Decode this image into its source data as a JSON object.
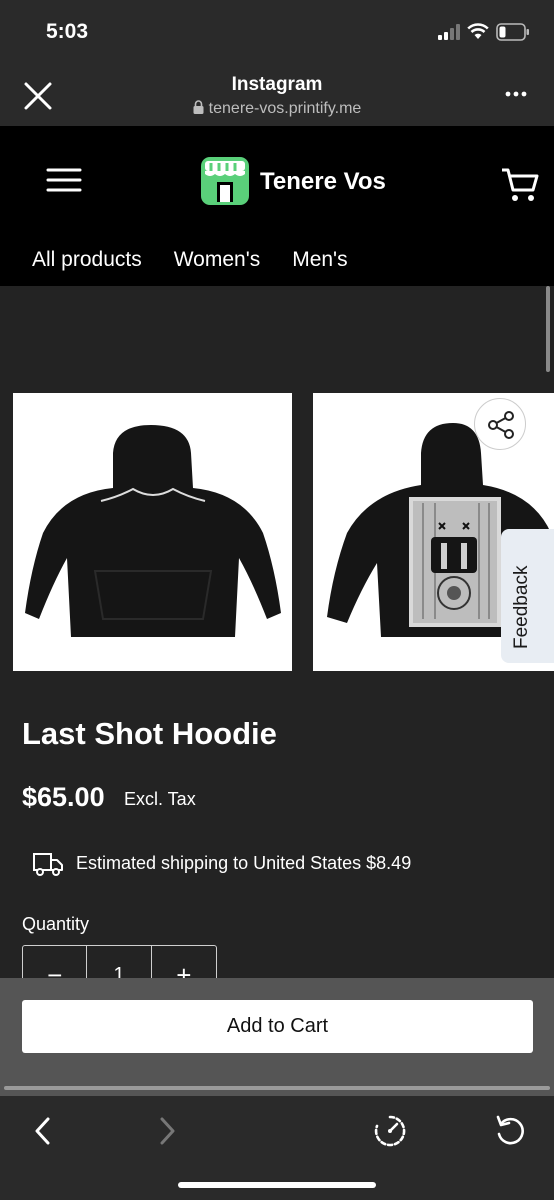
{
  "status_bar": {
    "time": "5:03"
  },
  "browser": {
    "title": "Instagram",
    "url": "tenere-vos.printify.me"
  },
  "store": {
    "brand": "Tenere Vos",
    "nav": [
      {
        "label": "All products"
      },
      {
        "label": "Women's"
      },
      {
        "label": "Men's"
      }
    ]
  },
  "product": {
    "title": "Last Shot Hoodie",
    "price": "$65.00",
    "tax_note": "Excl. Tax",
    "shipping": "Estimated shipping to United States $8.49",
    "quantity_label": "Quantity",
    "quantity": "1",
    "decrement": "−",
    "increment": "+"
  },
  "feedback_label": "Feedback",
  "add_to_cart_label": "Add to Cart",
  "icons": {
    "close": "close-icon",
    "more": "more-icon",
    "menu": "hamburger-menu-icon",
    "logo": "storefront-logo-icon",
    "cart": "shopping-cart-icon",
    "share": "share-icon",
    "truck": "truck-icon",
    "back": "chevron-left-icon",
    "forward": "chevron-right-icon",
    "speed": "speed-icon",
    "reload": "reload-icon"
  },
  "colors": {
    "header_bg": "#000000",
    "page_bg": "#232323",
    "logo_green": "#5ad07a",
    "button_bg": "#ffffff"
  }
}
